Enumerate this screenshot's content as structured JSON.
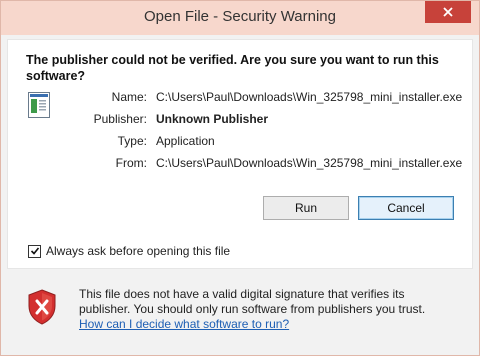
{
  "window": {
    "title": "Open File - Security Warning"
  },
  "question": "The publisher could not be verified.  Are you sure you want to run this software?",
  "details": {
    "name_label": "Name:",
    "name_value": "C:\\Users\\Paul\\Downloads\\Win_325798_mini_installer.exe",
    "publisher_label": "Publisher:",
    "publisher_value": "Unknown Publisher",
    "type_label": "Type:",
    "type_value": "Application",
    "from_label": "From:",
    "from_value": "C:\\Users\\Paul\\Downloads\\Win_325798_mini_installer.exe"
  },
  "buttons": {
    "run": "Run",
    "cancel": "Cancel"
  },
  "checkbox": {
    "label": "Always ask before opening this file",
    "checked": true
  },
  "warning": {
    "text": "This file does not have a valid digital signature that verifies its publisher.  You should only run software from publishers you trust.",
    "link": "How can I decide what software to run?"
  },
  "icons": {
    "close": "close-icon",
    "file": "application-file-icon",
    "shield": "security-shield-icon",
    "check": "checkmark-icon"
  },
  "colors": {
    "titlebar": "#f7d7cc",
    "close_button": "#c7423a",
    "shield_red": "#d32f2f",
    "link": "#1e5fb4"
  }
}
